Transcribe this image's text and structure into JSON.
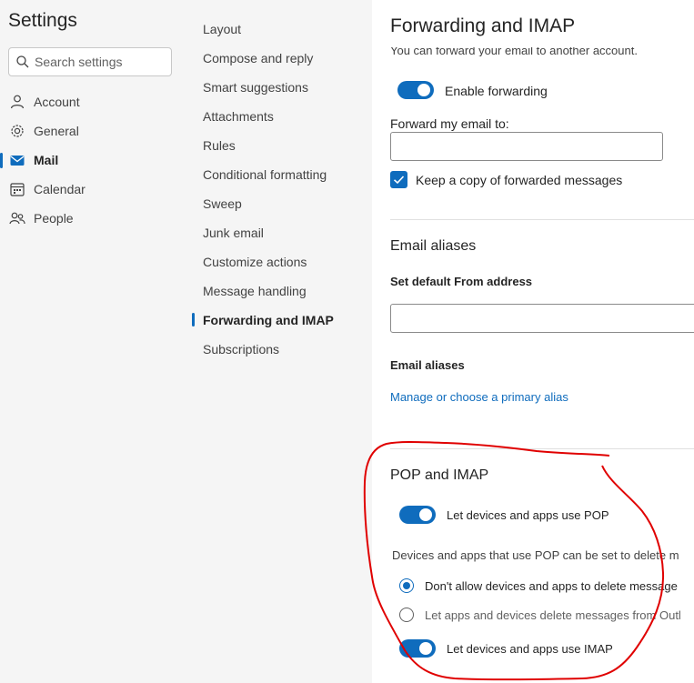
{
  "app": {
    "title": "Settings"
  },
  "search": {
    "placeholder": "Search settings"
  },
  "nav": {
    "items": [
      {
        "label": "Account",
        "icon": "person-icon"
      },
      {
        "label": "General",
        "icon": "gear-icon"
      },
      {
        "label": "Mail",
        "icon": "mail-icon",
        "active": true
      },
      {
        "label": "Calendar",
        "icon": "calendar-icon"
      },
      {
        "label": "People",
        "icon": "people-icon"
      }
    ]
  },
  "subnav": {
    "items": [
      {
        "label": "Layout"
      },
      {
        "label": "Compose and reply"
      },
      {
        "label": "Smart suggestions"
      },
      {
        "label": "Attachments"
      },
      {
        "label": "Rules"
      },
      {
        "label": "Conditional formatting"
      },
      {
        "label": "Sweep"
      },
      {
        "label": "Junk email"
      },
      {
        "label": "Customize actions"
      },
      {
        "label": "Message handling"
      },
      {
        "label": "Forwarding and IMAP",
        "active": true
      },
      {
        "label": "Subscriptions"
      }
    ]
  },
  "content": {
    "title": "Forwarding and IMAP",
    "forwarding": {
      "intro": "You can forward your email to another account.",
      "enable_label": "Enable forwarding",
      "enabled": true,
      "forward_to_label": "Forward my email to:",
      "forward_to_value": "",
      "keep_copy_label": "Keep a copy of forwarded messages",
      "keep_copy_checked": true
    },
    "aliases": {
      "heading": "Email aliases",
      "default_from_label": "Set default From address",
      "aliases_label": "Email aliases",
      "manage_link": "Manage or choose a primary alias"
    },
    "pop_imap": {
      "heading": "POP and IMAP",
      "pop_label": "Let devices and apps use POP",
      "pop_enabled": true,
      "pop_delete_desc": "Devices and apps that use POP can be set to delete m",
      "radio_dont_allow": "Don't allow devices and apps to delete message",
      "radio_dont_allow_selected": true,
      "radio_let_delete": "Let apps and devices delete messages from Outl",
      "imap_label": "Let devices and apps use IMAP",
      "imap_enabled": true
    }
  },
  "colors": {
    "accent": "#0f6cbd",
    "annotation": "#e00000",
    "pane_bg": "#f5f5f5"
  }
}
